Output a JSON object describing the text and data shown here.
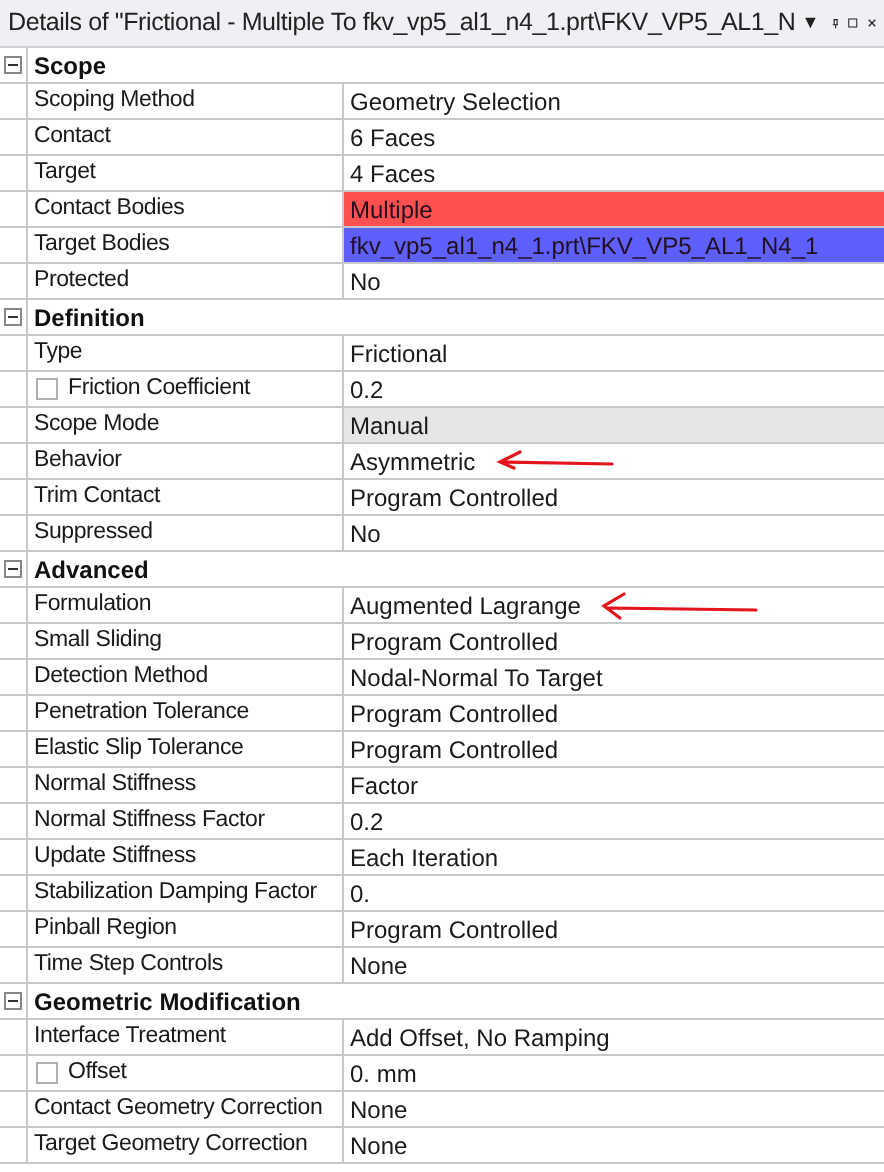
{
  "title_bar": {
    "title": "Details of \"Frictional - Multiple To fkv_vp5_al1_n4_1.prt\\FKV_VP5_AL1_N",
    "caret": "▼"
  },
  "sections": [
    {
      "name": "Scope",
      "expanded": true,
      "rows": [
        {
          "label": "Scoping Method",
          "value": "Geometry Selection",
          "kind": "text"
        },
        {
          "label": "Contact",
          "value": "6 Faces",
          "kind": "text"
        },
        {
          "label": "Target",
          "value": "4 Faces",
          "kind": "text"
        },
        {
          "label": "Contact Bodies",
          "value": "Multiple",
          "kind": "colored",
          "color": "#ff4f4f"
        },
        {
          "label": "Target Bodies",
          "value": "fkv_vp5_al1_n4_1.prt\\FKV_VP5_AL1_N4_1",
          "kind": "colored",
          "color": "#5e5efb"
        },
        {
          "label": "Protected",
          "value": "No",
          "kind": "text"
        }
      ]
    },
    {
      "name": "Definition",
      "expanded": true,
      "rows": [
        {
          "label": "Type",
          "value": "Frictional",
          "kind": "text"
        },
        {
          "label": "Friction Coefficient",
          "value": "0.2",
          "kind": "checkbox",
          "checked": false
        },
        {
          "label": "Scope Mode",
          "value": "Manual",
          "kind": "shaded"
        },
        {
          "label": "Behavior",
          "value": "Asymmetric",
          "kind": "text",
          "annotated": true
        },
        {
          "label": "Trim Contact",
          "value": "Program Controlled",
          "kind": "text"
        },
        {
          "label": "Suppressed",
          "value": "No",
          "kind": "text"
        }
      ]
    },
    {
      "name": "Advanced",
      "expanded": true,
      "rows": [
        {
          "label": "Formulation",
          "value": "Augmented Lagrange",
          "kind": "text",
          "annotated": true
        },
        {
          "label": "Small Sliding",
          "value": "Program Controlled",
          "kind": "text"
        },
        {
          "label": "Detection Method",
          "value": "Nodal-Normal To Target",
          "kind": "text"
        },
        {
          "label": "Penetration Tolerance",
          "value": "Program Controlled",
          "kind": "text"
        },
        {
          "label": "Elastic Slip Tolerance",
          "value": "Program Controlled",
          "kind": "text"
        },
        {
          "label": "Normal Stiffness",
          "value": "Factor",
          "kind": "text"
        },
        {
          "label": "Normal Stiffness Factor",
          "value": "0.2",
          "kind": "text"
        },
        {
          "label": "Update Stiffness",
          "value": "Each Iteration",
          "kind": "text"
        },
        {
          "label": "Stabilization Damping Factor",
          "value": "0.",
          "kind": "text"
        },
        {
          "label": "Pinball Region",
          "value": "Program Controlled",
          "kind": "text"
        },
        {
          "label": "Time Step Controls",
          "value": "None",
          "kind": "text"
        }
      ]
    },
    {
      "name": "Geometric Modification",
      "expanded": true,
      "rows": [
        {
          "label": "Interface Treatment",
          "value": "Add Offset, No Ramping",
          "kind": "text"
        },
        {
          "label": "Offset",
          "value": "0. mm",
          "kind": "checkbox",
          "checked": false
        },
        {
          "label": "Contact Geometry Correction",
          "value": "None",
          "kind": "text"
        },
        {
          "label": "Target Geometry Correction",
          "value": "None",
          "kind": "text"
        }
      ]
    }
  ]
}
